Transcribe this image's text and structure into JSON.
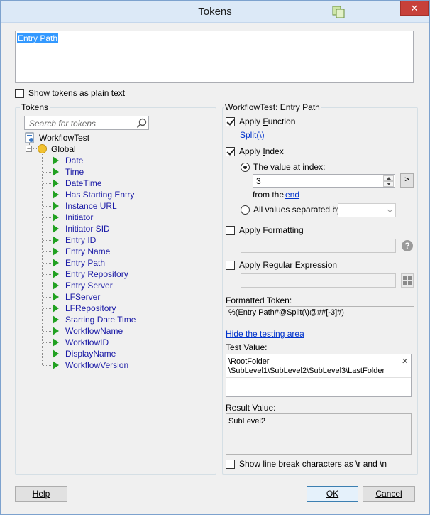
{
  "window": {
    "title": "Tokens",
    "close_glyph": "✕",
    "app_icon": "copy-documents-icon"
  },
  "token_text": "Entry Path",
  "show_plain_text_label": "Show tokens as plain text",
  "tokens_panel": {
    "title": "Tokens",
    "search_placeholder": "Search for tokens",
    "root": "WorkflowTest",
    "group": "Global",
    "collapse_glyph": "−",
    "items": [
      "Date",
      "Time",
      "DateTime",
      "Has Starting Entry",
      "Instance URL",
      "Initiator",
      "Initiator SID",
      "Entry ID",
      "Entry Name",
      "Entry Path",
      "Entry Repository",
      "Entry Server",
      "LFServer",
      "LFRepository",
      "Starting Date Time",
      "WorkflowName",
      "WorkflowID",
      "DisplayName",
      "WorkflowVersion"
    ]
  },
  "details": {
    "title": "WorkflowTest: Entry Path",
    "apply_function_pre": "Apply ",
    "apply_function_key": "F",
    "apply_function_post": "unction",
    "function_link": "Split(\\)",
    "apply_index_pre": "Apply ",
    "apply_index_key": "I",
    "apply_index_post": "ndex",
    "value_at_index_label": "The value at index:",
    "index_value": "3",
    "arrow_button": ">",
    "from_the_label": "from the",
    "from_the_link": "end",
    "all_values_label": "All values separated by:",
    "apply_formatting_pre": "Apply ",
    "apply_formatting_key": "F",
    "apply_formatting_post": "ormatting",
    "help_glyph": "?",
    "apply_regex_pre": "Apply ",
    "apply_regex_key": "R",
    "apply_regex_post": "egular Expression",
    "formatted_token_label": "Formatted Token:",
    "formatted_token_value": "%(Entry Path#@Split(\\)@##[-3]#)",
    "hide_testing_link": "Hide the testing area",
    "test_value_label": "Test Value:",
    "test_value": "\\RootFolder\n\\SubLevel1\\SubLevel2\\SubLevel3\\LastFolder",
    "clear_glyph": "✕",
    "result_value_label": "Result Value:",
    "result_value": "SubLevel2",
    "line_break_label": "Show line break characters as \\r and \\n"
  },
  "buttons": {
    "help": "Help",
    "ok": "OK",
    "cancel": "Cancel"
  }
}
